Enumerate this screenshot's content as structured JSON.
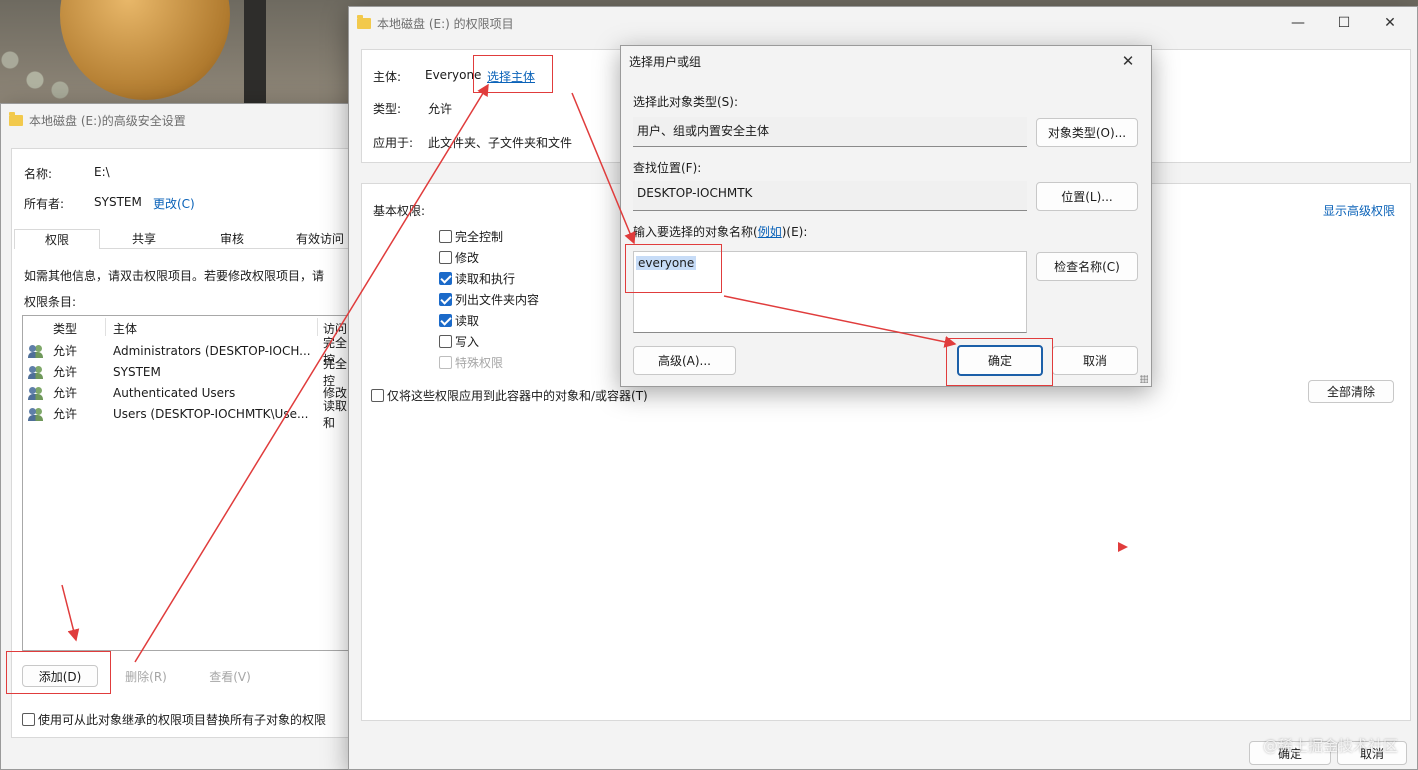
{
  "background": {
    "accent": "#e03c3c"
  },
  "adv_window": {
    "title": "本地磁盘 (E:)的高级安全设置",
    "name_label": "名称:",
    "name_value": "E:\\",
    "owner_label": "所有者:",
    "owner_value": "SYSTEM",
    "change_link": "更改(C)",
    "tabs": [
      "权限",
      "共享",
      "审核",
      "有效访问"
    ],
    "info_text": "如需其他信息，请双击权限项目。若要修改权限项目，请",
    "entries_label": "权限条目:",
    "columns": [
      "类型",
      "主体",
      "访问"
    ],
    "rows": [
      {
        "type": "允许",
        "principal": "Administrators (DESKTOP-IOCH...",
        "access": "完全控"
      },
      {
        "type": "允许",
        "principal": "SYSTEM",
        "access": "完全控"
      },
      {
        "type": "允许",
        "principal": "Authenticated Users",
        "access": "修改"
      },
      {
        "type": "允许",
        "principal": "Users (DESKTOP-IOCHMTK\\Use...",
        "access": "读取和"
      }
    ],
    "add_button": "添加(D)",
    "remove_button": "删除(R)",
    "view_button": "查看(V)",
    "replace_checkbox": "使用可从此对象继承的权限项目替换所有子对象的权限"
  },
  "perm_window": {
    "title": "本地磁盘 (E:) 的权限项目",
    "principal_label": "主体:",
    "principal_value": "Everyone",
    "select_principal_link": "选择主体",
    "type_label": "类型:",
    "type_value": "允许",
    "applies_label": "应用于:",
    "applies_value": "此文件夹、子文件夹和文件",
    "basic_perms_label": "基本权限:",
    "show_advanced_link": "显示高级权限",
    "permissions": [
      {
        "label": "完全控制",
        "checked": false,
        "disabled": false
      },
      {
        "label": "修改",
        "checked": false,
        "disabled": false
      },
      {
        "label": "读取和执行",
        "checked": true,
        "disabled": false
      },
      {
        "label": "列出文件夹内容",
        "checked": true,
        "disabled": false
      },
      {
        "label": "读取",
        "checked": true,
        "disabled": false
      },
      {
        "label": "写入",
        "checked": false,
        "disabled": false
      },
      {
        "label": "特殊权限",
        "checked": false,
        "disabled": true
      }
    ],
    "apply_only_checkbox": "仅将这些权限应用到此容器中的对象和/或容器(T)",
    "clear_all_button": "全部清除",
    "ok_button": "确定",
    "cancel_button": "取消",
    "minimize_glyph": "—",
    "maximize_glyph": "☐",
    "close_glyph": "✕"
  },
  "select_dialog": {
    "title": "选择用户或组",
    "close_glyph": "✕",
    "object_type_label": "选择此对象类型(S):",
    "object_type_value": "用户、组或内置安全主体",
    "object_types_button": "对象类型(O)...",
    "location_label": "查找位置(F):",
    "location_value": "DESKTOP-IOCHMTK",
    "locations_button": "位置(L)...",
    "enter_names_label_pre": "输入要选择的对象名称(",
    "enter_names_example_link": "例如",
    "enter_names_label_post": ")(E):",
    "names_value": "everyone",
    "check_names_button": "检查名称(C)",
    "advanced_button": "高级(A)...",
    "ok_button": "确定",
    "cancel_button": "取消"
  },
  "watermark": "@稀土掘金技术社区"
}
